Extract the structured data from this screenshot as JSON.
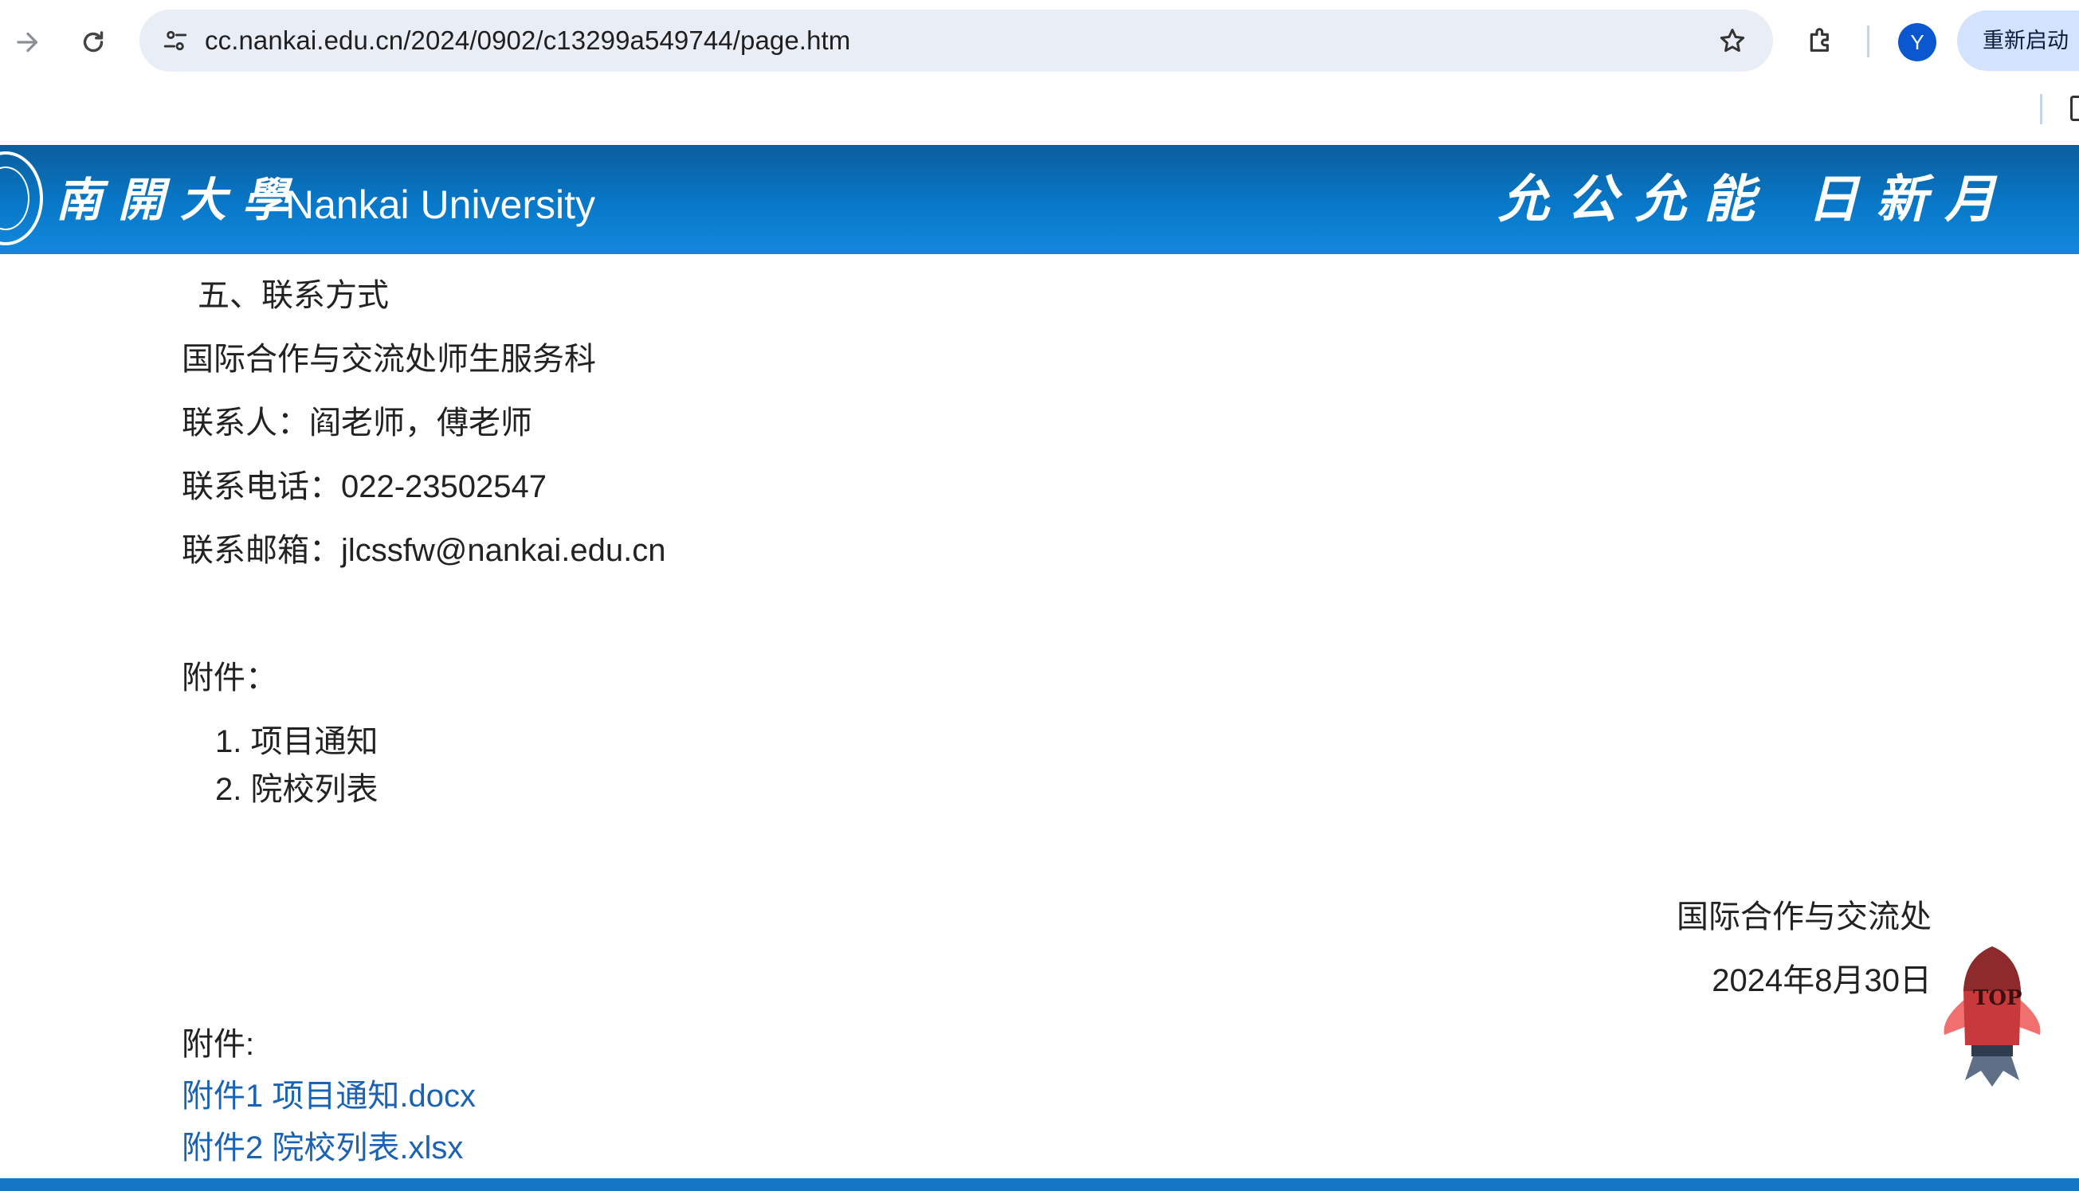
{
  "browser": {
    "url": "cc.nankai.edu.cn/2024/0902/c13299a549744/page.htm",
    "avatar_letter": "Y",
    "relaunch_label": "重新启动"
  },
  "banner": {
    "logo_chinese": "南開大學",
    "logo_english": "Nankai University",
    "motto": "允公允能 日新月",
    "colors": {
      "top": "#0b5e9c",
      "bottom": "#1389dc"
    }
  },
  "article": {
    "section_heading": "五、联系方式",
    "office": "国际合作与交流处师生服务科",
    "contact_person": "联系人：阎老师，傅老师",
    "phone": "联系电话：022-23502547",
    "email": "联系邮箱：jlcssfw@nankai.edu.cn",
    "attachments_label": "附件：",
    "attachment_list": [
      "1. 项目通知",
      "2. 院校列表"
    ],
    "signature_org": "国际合作与交流处",
    "signature_date": "2024年8月30日",
    "file_attachments_label": "附件:",
    "file_links": [
      "附件1 项目通知.docx",
      "附件2 院校列表.xlsx"
    ],
    "link_color": "#1a63b4"
  },
  "back_to_top": {
    "label": "TOP"
  }
}
